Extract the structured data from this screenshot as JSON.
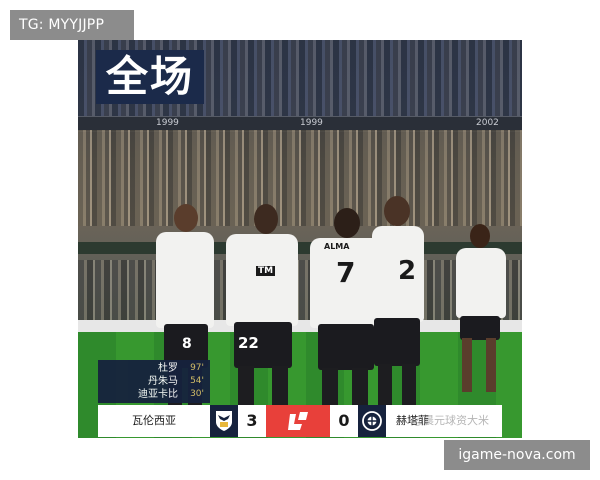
{
  "watermark_top": "TG: MYYJJPP",
  "watermark_bottom": "igame-nova.com",
  "photo": {
    "title": "全场",
    "stand_labels": [
      "1999",
      "1999",
      "2002"
    ],
    "jersey_numbers": [
      "8",
      "22",
      "7",
      "2"
    ],
    "shirt_name": "ALMA",
    "shirt_sponsor": "TM"
  },
  "scorers": [
    {
      "name": "杜罗",
      "minute": "97'"
    },
    {
      "name": "丹朱马",
      "minute": "54'"
    },
    {
      "name": "迪亚卡比",
      "minute": "30'"
    }
  ],
  "scoreboard": {
    "home_team": "瓦伦西亚",
    "home_score": "3",
    "away_score": "0",
    "away_team": "赫塔菲",
    "overlay_watermark": "@晨元球资大米"
  },
  "colors": {
    "navy": "#16223d",
    "league_red": "#e8403a",
    "watermark_gray": "#8c8c8c"
  },
  "icons": {
    "home_crest": "valencia-bat-crest-icon",
    "league_logo": "laliga-logo-icon",
    "away_crest": "getafe-crest-icon"
  }
}
